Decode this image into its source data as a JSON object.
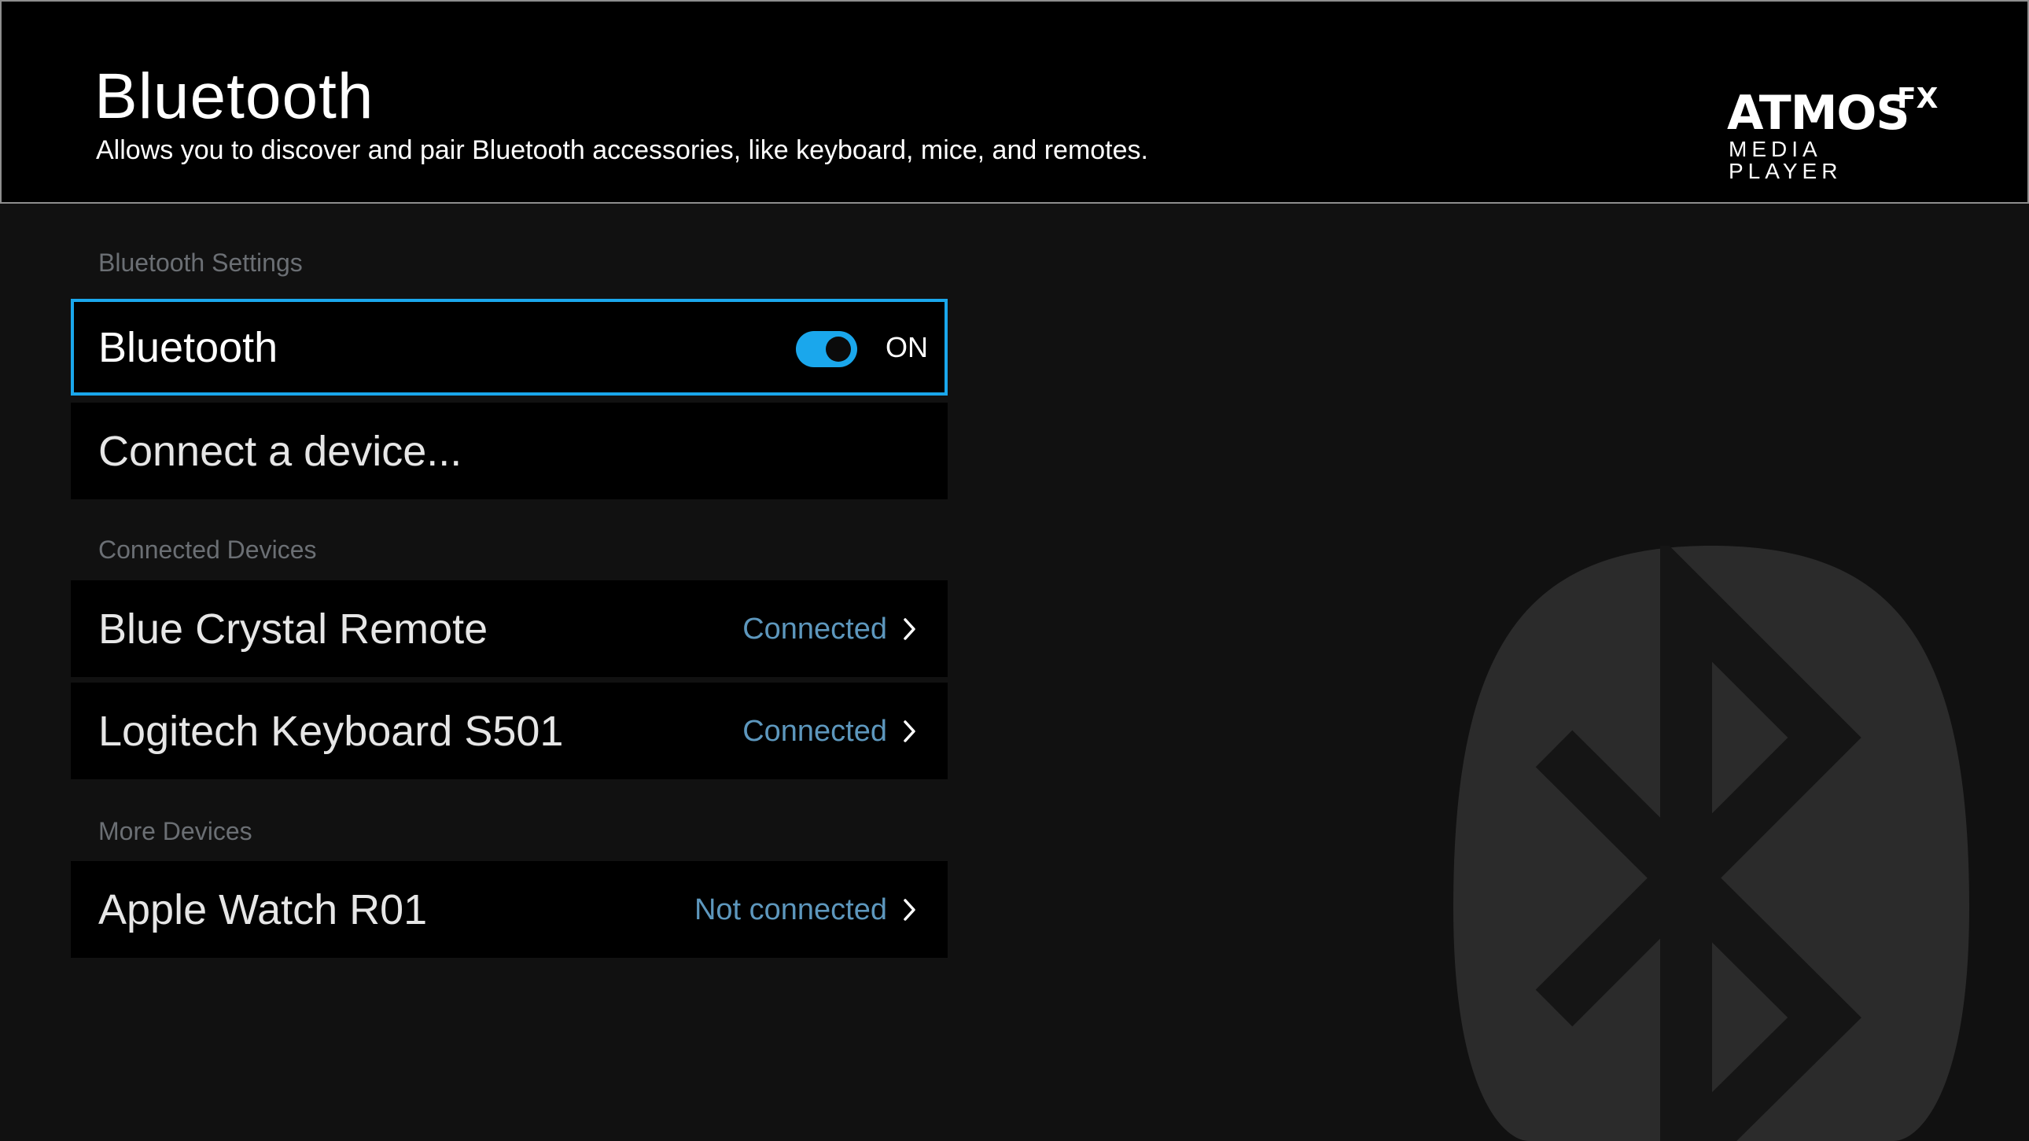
{
  "header": {
    "title": "Bluetooth",
    "subtitle": "Allows you to discover and pair Bluetooth accessories, like keyboard, mice, and remotes.",
    "brand": {
      "main": "ATMOS",
      "suffix": "FX",
      "sub": "MEDIA PLAYER"
    }
  },
  "sections": {
    "settings": "Bluetooth Settings",
    "connected": "Connected Devices",
    "more": "More Devices"
  },
  "settings": {
    "bluetooth_label": "Bluetooth",
    "bluetooth_state": "ON",
    "bluetooth_on": true,
    "connect_label": "Connect a device..."
  },
  "connected_devices": [
    {
      "name": "Blue Crystal Remote",
      "status": "Connected"
    },
    {
      "name": "Logitech Keyboard S501",
      "status": "Connected"
    }
  ],
  "more_devices": [
    {
      "name": "Apple Watch R01",
      "status": "Not connected"
    }
  ],
  "colors": {
    "accent": "#1aa7ec",
    "status": "#5d97bd",
    "background": "#111111",
    "row": "#000000",
    "section_label": "#6b6f74"
  },
  "icons": [
    "chevron-right-icon",
    "bluetooth-icon"
  ]
}
